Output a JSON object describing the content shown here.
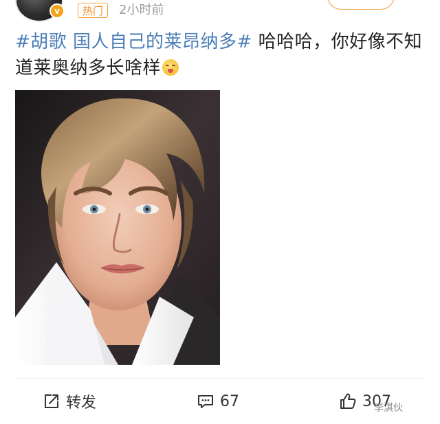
{
  "header": {
    "verify_badge": "v",
    "hot_tag": "热门",
    "post_time": "2小时前"
  },
  "post": {
    "topic": "#胡歌 国人自己的莱昂纳多#",
    "text": " 哈哈哈，你好像不知道莱奥纳多长啥样",
    "emoji": "laughing-with-hand-over-mouth"
  },
  "actions": {
    "repost_label": "转发",
    "comment_count": "67",
    "like_count": "307"
  },
  "watermark": "李淇伙",
  "colors": {
    "topic_link": "#4a7db8",
    "hot_tag": "#f08a1a",
    "verify_badge": "#f3a21b",
    "time_text": "#9a9a9a"
  },
  "icons": {
    "repost": "share-square-icon",
    "comment": "speech-bubble-icon",
    "like": "thumbs-up-icon"
  }
}
